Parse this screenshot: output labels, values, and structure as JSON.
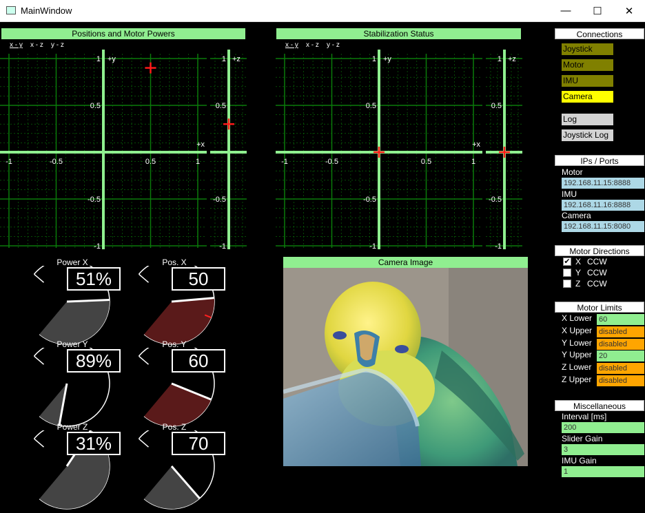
{
  "window": {
    "title": "MainWindow",
    "minimize": "—",
    "maximize": "☐",
    "close": "✕"
  },
  "positions": {
    "title": "Positions and Motor Powers",
    "tabs": [
      "x - y",
      "x - z",
      "y - z"
    ],
    "ticks_x": [
      "-1",
      "-0.5",
      "0.5",
      "1"
    ],
    "ticks_y": [
      "1",
      "0.5",
      "-0.5",
      "-1"
    ],
    "axis_y_label": "+y",
    "axis_x_label": "+x",
    "axis_z_label": "+z",
    "ticks_z": [
      "1",
      "0.5",
      "-0.5",
      "-1"
    ],
    "xy_point": [
      0.5,
      0.9
    ],
    "z_point": 0.3
  },
  "stabilization": {
    "title": "Stabilization Status",
    "tabs": [
      "x - y",
      "x - z",
      "y - z"
    ],
    "ticks_x": [
      "-1",
      "-0.5",
      "0.5",
      "1"
    ],
    "ticks_y": [
      "1",
      "0.5",
      "-0.5",
      "-1"
    ],
    "axis_y_label": "+y",
    "axis_x_label": "+x",
    "axis_z_label": "+z",
    "ticks_z": [
      "1",
      "0.5",
      "-0.5",
      "-1"
    ],
    "xy_point": [
      0,
      0
    ],
    "z_point": 0
  },
  "gauges": [
    {
      "label": "Power X",
      "value": "51%",
      "fraction": 0.51,
      "color": "#444444"
    },
    {
      "label": "Pos. X",
      "value": "50",
      "fraction": 0.5,
      "color": "#5a1a1a",
      "marker": 0.6
    },
    {
      "label": "Power Y",
      "value": "89%",
      "fraction": 0.89,
      "color": "#444444"
    },
    {
      "label": "Pos. Y",
      "value": "60",
      "fraction": 0.6,
      "color": "#5a1a1a",
      "marker": 0.2
    },
    {
      "label": "Power Z",
      "value": "31%",
      "fraction": 0.31,
      "color": "#444444"
    },
    {
      "label": "Pos. Z",
      "value": "70",
      "fraction": 0.7,
      "color": "#444444"
    }
  ],
  "camera": {
    "title": "Camera Image"
  },
  "connections": {
    "title": "Connections",
    "joystick": "Joystick",
    "motor": "Motor",
    "imu": "IMU",
    "camera": "Camera",
    "log": "Log",
    "joystick_log": "Joystick Log",
    "colors": {
      "inactive": "#808000",
      "active": "#ffff00",
      "gray": "#d3d3d3"
    }
  },
  "ips": {
    "title": "IPs / Ports",
    "motor_label": "Motor",
    "motor_value": "192.168.11.15:8888",
    "imu_label": "IMU",
    "imu_value": "192.168.11.16:8888",
    "camera_label": "Camera",
    "camera_value": "192.168.11.15:8080"
  },
  "motor_directions": {
    "title": "Motor Directions",
    "rows": [
      {
        "axis": "X",
        "dir": "CCW",
        "checked": "✔"
      },
      {
        "axis": "Y",
        "dir": "CCW",
        "checked": ""
      },
      {
        "axis": "Z",
        "dir": "CCW",
        "checked": ""
      }
    ]
  },
  "motor_limits": {
    "title": "Motor Limits",
    "rows": [
      {
        "label": "X Lower",
        "value": "60",
        "color": "#90ee90"
      },
      {
        "label": "X Upper",
        "value": "disabled",
        "color": "#ffa500"
      },
      {
        "label": "Y Lower",
        "value": "disabled",
        "color": "#ffa500"
      },
      {
        "label": "Y Upper",
        "value": "20",
        "color": "#90ee90"
      },
      {
        "label": "Z Lower",
        "value": "disabled",
        "color": "#ffa500"
      },
      {
        "label": "Z Upper",
        "value": "disabled",
        "color": "#ffa500"
      }
    ]
  },
  "misc": {
    "title": "Miscellaneous",
    "interval_label": "Interval [ms]",
    "interval_value": "200",
    "slider_label": "Slider Gain",
    "slider_value": "3",
    "imu_gain_label": "IMU Gain",
    "imu_gain_value": "1"
  }
}
